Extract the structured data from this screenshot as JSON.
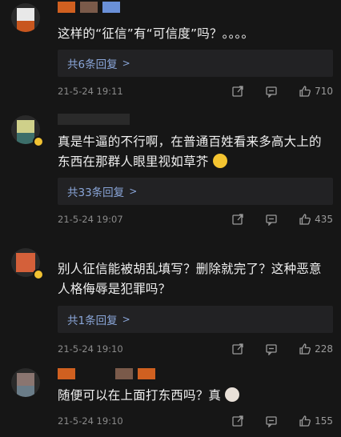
{
  "comments": [
    {
      "text": "这样的“征信”有“可信度”吗？。。。。",
      "reply_label": "共6条回复",
      "time": "21-5-24 19:11",
      "likes": "710"
    },
    {
      "text": "真是牛逼的不行啊，在普通百姓看来多高大上的东西在那群人眼里视如草芥",
      "emoji": "face-with-hand-emoji",
      "reply_label": "共33条回复",
      "time": "21-5-24 19:07",
      "likes": "435"
    },
    {
      "text": "别人征信能被胡乱填写？删除就完了？这种恶意人格侮辱是犯罪吗？",
      "reply_label": "共1条回复",
      "time": "21-5-24 19:10",
      "likes": "228"
    },
    {
      "text": "随便可以在上面打东西吗？真",
      "emoji": "cow-face-emoji",
      "time": "21-5-24 19:10",
      "likes": "155"
    }
  ],
  "reply_arrow": ">",
  "colors": {
    "accent_link": "#8aa6d9",
    "background": "#161616",
    "reply_bg": "#222224"
  }
}
